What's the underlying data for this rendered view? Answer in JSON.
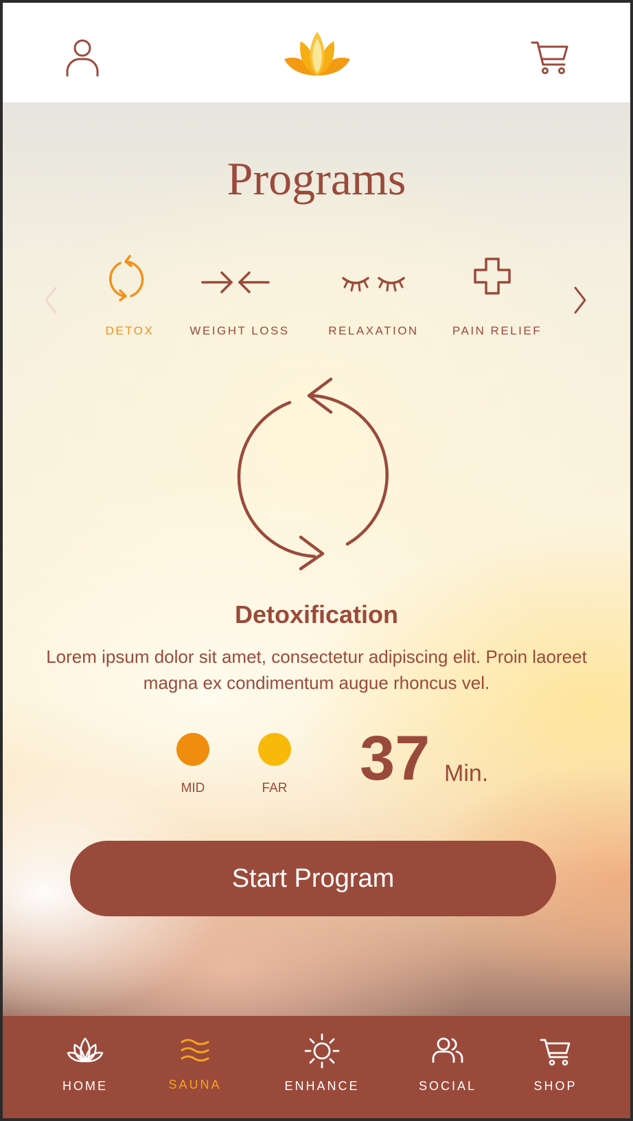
{
  "header": {
    "profile_icon": "user-icon",
    "logo_icon": "lotus-logo",
    "cart_icon": "cart-icon"
  },
  "main": {
    "title": "Programs",
    "tabs": [
      {
        "label": "DETOX",
        "icon": "refresh-icon",
        "active": true
      },
      {
        "label": "WEIGHT LOSS",
        "icon": "arrows-inward-icon",
        "active": false
      },
      {
        "label": "RELAXATION",
        "icon": "closed-eyes-icon",
        "active": false
      },
      {
        "label": "PAIN RELIEF",
        "icon": "cross-icon",
        "active": false
      }
    ],
    "program": {
      "name": "Detoxification",
      "description": "Lorem ipsum dolor sit amet, consectetur adipiscing elit. Proin laoreet magna ex condimentum augue rhoncus vel.",
      "icon": "refresh-icon"
    },
    "heat_levels": [
      {
        "label": "MID",
        "color": "#f08c0e"
      },
      {
        "label": "FAR",
        "color": "#f9b90a"
      }
    ],
    "duration": {
      "value": "37",
      "unit": "Min."
    },
    "start_label": "Start Program"
  },
  "nav": {
    "items": [
      {
        "label": "HOME",
        "icon": "lotus-icon",
        "active": false
      },
      {
        "label": "SAUNA",
        "icon": "waves-icon",
        "active": true
      },
      {
        "label": "ENHANCE",
        "icon": "sun-icon",
        "active": false
      },
      {
        "label": "SOCIAL",
        "icon": "users-icon",
        "active": false
      },
      {
        "label": "SHOP",
        "icon": "cart-icon",
        "active": false
      }
    ]
  },
  "colors": {
    "brand": "#9a4a3b",
    "accent": "#f0921a",
    "accent_light": "#f9b90a",
    "nav_active": "#f6a31c"
  }
}
